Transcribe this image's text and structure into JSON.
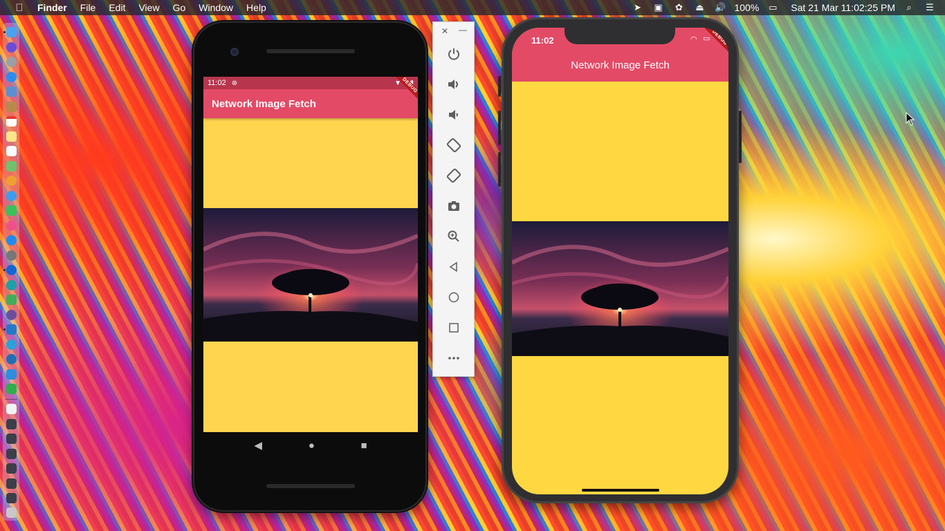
{
  "menubar": {
    "app_name": "Finder",
    "items": [
      "File",
      "Edit",
      "View",
      "Go",
      "Window",
      "Help"
    ],
    "battery": "100%",
    "clock": "Sat 21 Mar  11:02:25 PM"
  },
  "android": {
    "status_time": "11:02",
    "app_title": "Network Image Fetch",
    "debug_label": "DEBUG",
    "nav": {
      "back": "◀",
      "home": "●",
      "recents": "■"
    }
  },
  "emulator_toolbar": {
    "close": "✕",
    "minimize": "—",
    "buttons": [
      "power-icon",
      "volume-up-icon",
      "volume-down-icon",
      "rotate-left-icon",
      "rotate-right-icon",
      "camera-icon",
      "zoom-icon",
      "back-icon",
      "home-icon",
      "overview-icon",
      "more-icon"
    ]
  },
  "iphone": {
    "status_time": "11:02",
    "app_title": "Network Image Fetch",
    "debug_label": "DEBUG"
  },
  "colors": {
    "appbar": "#e34a66",
    "android_status": "#b8364d",
    "body_yellow": "#ffd54f"
  }
}
